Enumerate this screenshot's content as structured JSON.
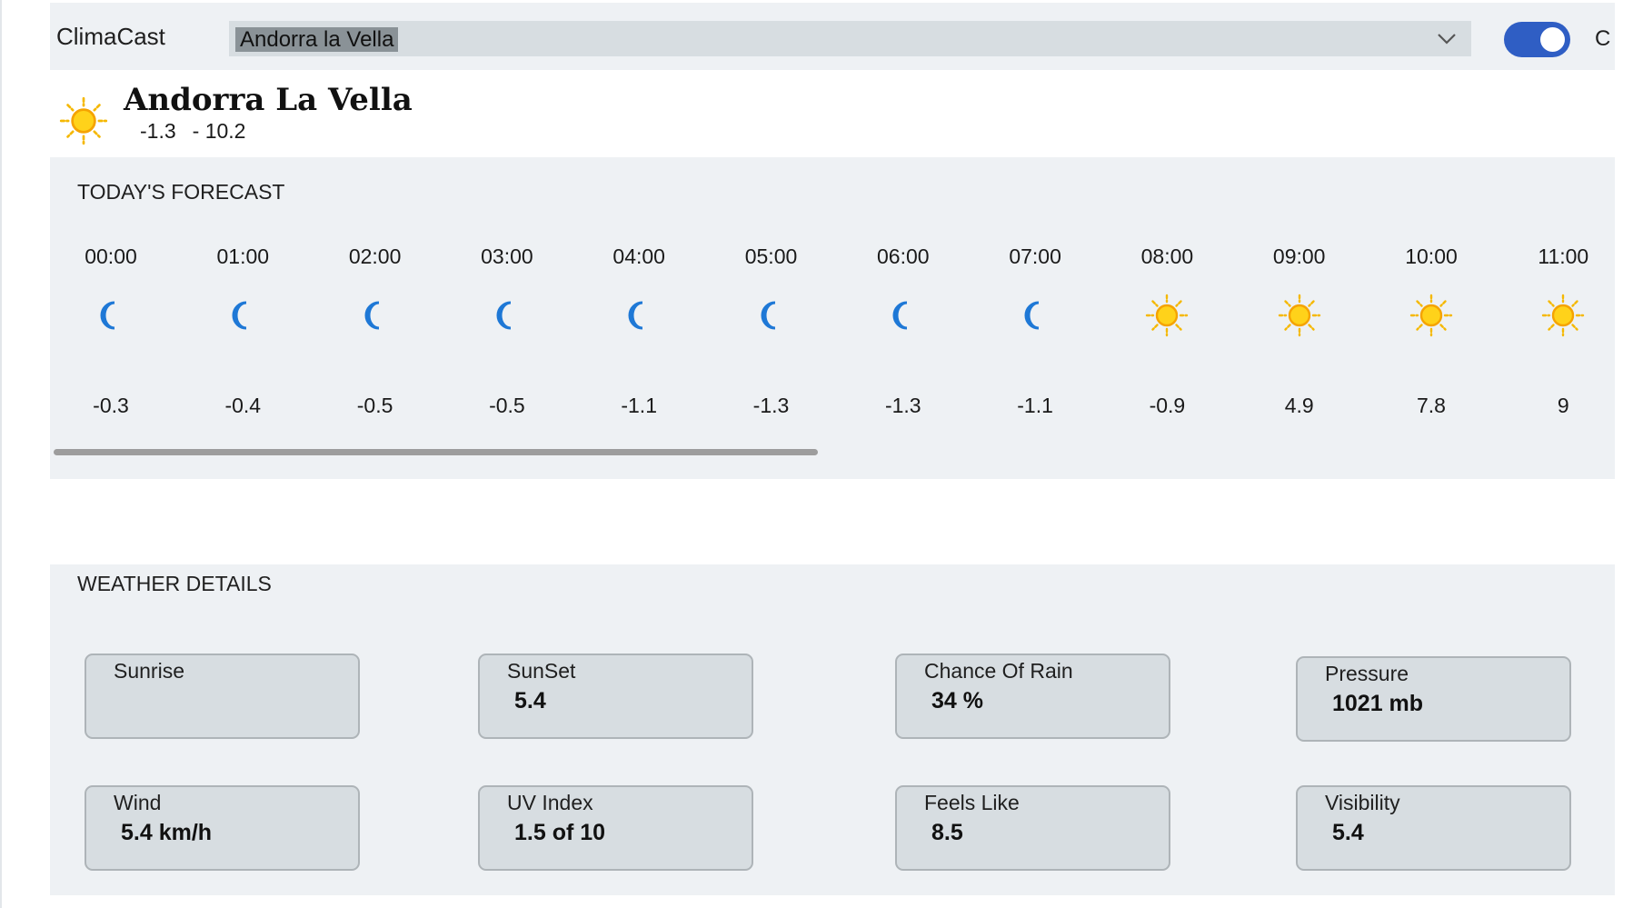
{
  "app": {
    "title": "ClimaCast"
  },
  "search": {
    "selected_city": "Andorra la Vella"
  },
  "units": {
    "toggle_on": true,
    "label": "C"
  },
  "current": {
    "city": "Andorra La Vella",
    "temp_min": "-1.3",
    "temp_max": "- 10.2",
    "icon": "sun-icon"
  },
  "forecast": {
    "title": "TODAY'S FORECAST",
    "hours": [
      {
        "time": "00:00",
        "icon": "moon-icon",
        "temp": "-0.3"
      },
      {
        "time": "01:00",
        "icon": "moon-icon",
        "temp": "-0.4"
      },
      {
        "time": "02:00",
        "icon": "moon-icon",
        "temp": "-0.5"
      },
      {
        "time": "03:00",
        "icon": "moon-icon",
        "temp": "-0.5"
      },
      {
        "time": "04:00",
        "icon": "moon-icon",
        "temp": "-1.1"
      },
      {
        "time": "05:00",
        "icon": "moon-icon",
        "temp": "-1.3"
      },
      {
        "time": "06:00",
        "icon": "moon-icon",
        "temp": "-1.3"
      },
      {
        "time": "07:00",
        "icon": "moon-icon",
        "temp": "-1.1"
      },
      {
        "time": "08:00",
        "icon": "sun-icon",
        "temp": "-0.9"
      },
      {
        "time": "09:00",
        "icon": "sun-icon",
        "temp": "4.9"
      },
      {
        "time": "10:00",
        "icon": "sun-icon",
        "temp": "7.8"
      },
      {
        "time": "11:00",
        "icon": "sun-icon",
        "temp": "9"
      }
    ]
  },
  "details": {
    "title": "WEATHER DETAILS",
    "cards": [
      {
        "label": "Sunrise",
        "value": ""
      },
      {
        "label": "SunSet",
        "value": "5.4"
      },
      {
        "label": "Chance Of Rain",
        "value": "34 %"
      },
      {
        "label": "Pressure",
        "value": "1021 mb"
      },
      {
        "label": "Wind",
        "value": "5.4 km/h"
      },
      {
        "label": "UV Index",
        "value": "1.5 of 10"
      },
      {
        "label": "Feels Like",
        "value": "8.5"
      },
      {
        "label": "Visibility",
        "value": "5.4"
      }
    ]
  },
  "colors": {
    "accent": "#2f5ec4",
    "panel": "#eef1f4",
    "card": "#d7dde1",
    "sun": "#f5b800",
    "moon": "#1e78d6"
  }
}
